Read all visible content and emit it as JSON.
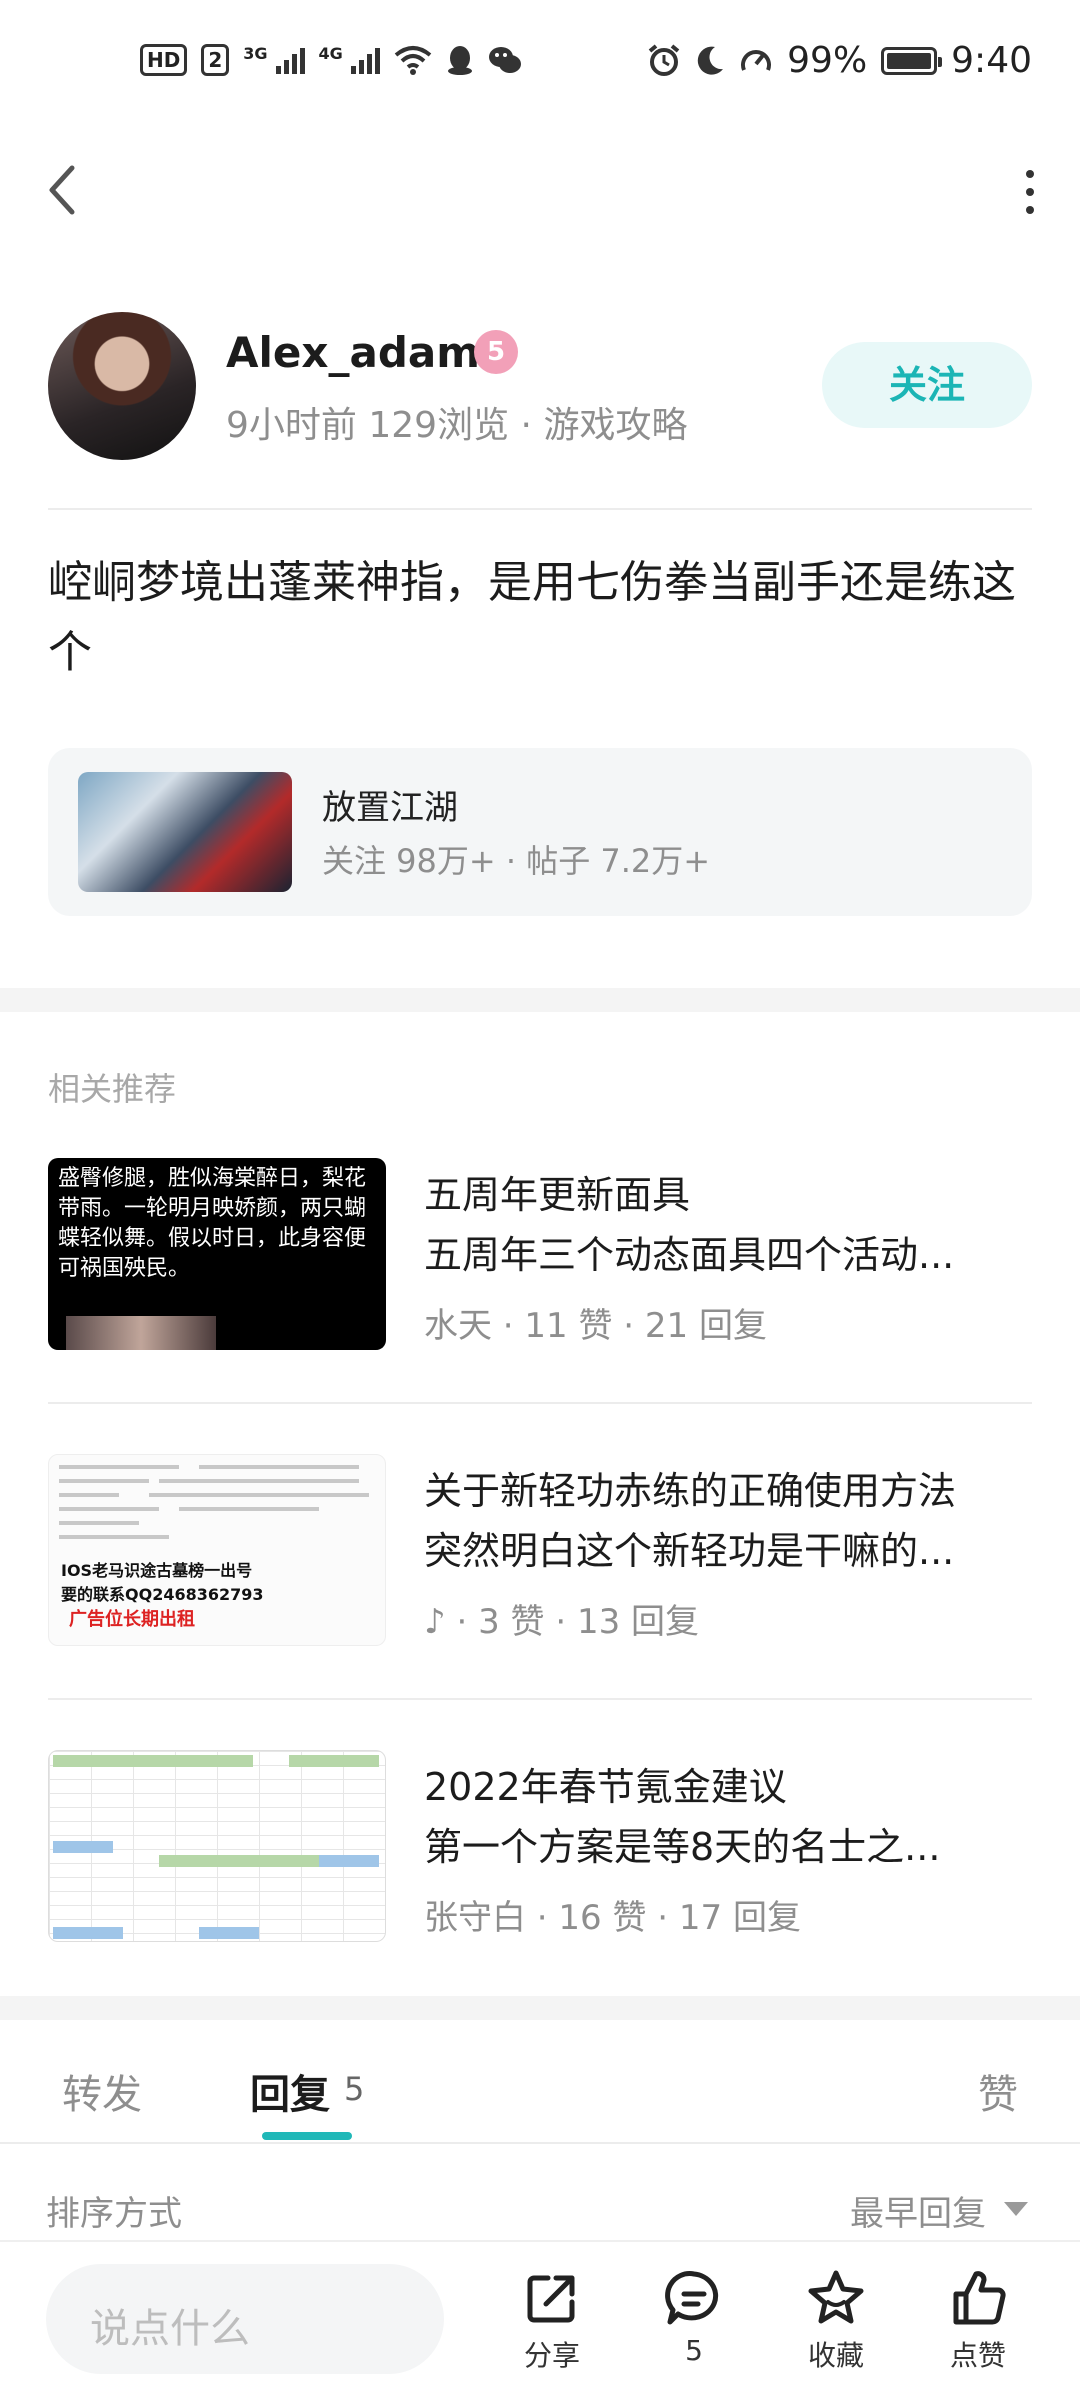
{
  "status_bar": {
    "hd": "HD",
    "sim": "2",
    "net1": "3G",
    "net2": "4G",
    "battery_pct": "99%",
    "time": "9:40"
  },
  "author": {
    "name": "Alex_adams",
    "level": "5",
    "time_ago": "9小时前",
    "views": "129浏览",
    "separator": "·",
    "category": "游戏攻略",
    "follow_label": "关注"
  },
  "post": {
    "title": "崆峒梦境出蓬莱神指，是用七伤拳当副手还是练这个"
  },
  "forum": {
    "name": "放置江湖",
    "stats": "关注 98万+ · 帖子 7.2万+"
  },
  "related": {
    "heading": "相关推荐",
    "items": [
      {
        "title": "五周年更新面具",
        "excerpt": "五周年三个动态面具四个活动...",
        "meta": "水天 · 11 赞 · 21 回复",
        "thumb_text": "盛臀修腿，胜似海棠醉日，梨花带雨。一轮明月映娇颜，两只蝴蝶轻似舞。假以时日，此身容便可祸国殃民。"
      },
      {
        "title": "关于新轻功赤练的正确使用方法",
        "excerpt": "突然明白这个新轻功是干嘛的...",
        "meta": "♪ · 3 赞 · 13 回复",
        "thumb_text_1": "IOS老马识途古墓榜一出号",
        "thumb_text_2": "要的联系QQ2468362793",
        "thumb_text_3": "广告位长期出租"
      },
      {
        "title": "2022年春节氪金建议",
        "excerpt": "第一个方案是等8天的名士之...",
        "meta": "张守白 · 16 赞 · 17 回复"
      }
    ]
  },
  "tabs": {
    "forward": "转发",
    "reply": "回复",
    "reply_count": "5",
    "like": "赞"
  },
  "sort": {
    "label": "排序方式",
    "value": "最早回复"
  },
  "bottom_bar": {
    "input_placeholder": "说点什么",
    "share": "分享",
    "comments": "5",
    "favorite": "收藏",
    "like": "点赞"
  },
  "colors": {
    "accent": "#20b8b8",
    "follow_bg": "#e8f8f8",
    "level_badge": "#f2a0b8"
  }
}
